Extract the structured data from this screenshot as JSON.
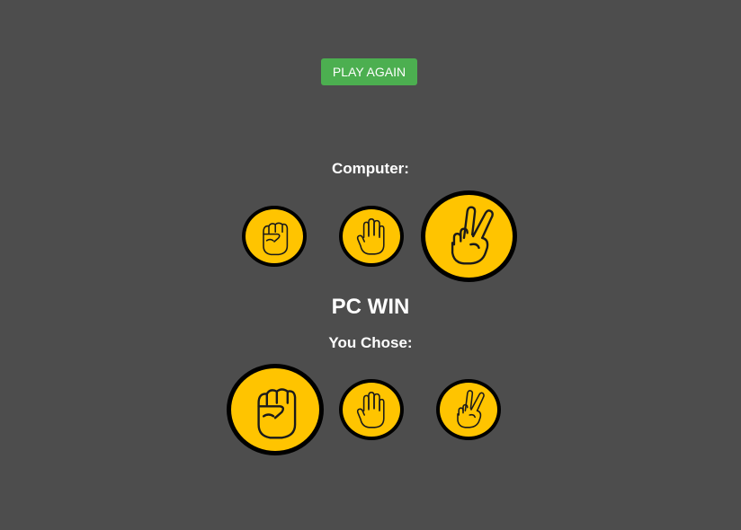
{
  "controls": {
    "play_again_label": "PLAY AGAIN"
  },
  "computer": {
    "label": "Computer:",
    "choices": [
      {
        "name": "rock",
        "icon": "rock-fist-icon",
        "selected": false
      },
      {
        "name": "paper",
        "icon": "paper-hand-icon",
        "selected": false
      },
      {
        "name": "scissors",
        "icon": "scissors-hand-icon",
        "selected": true
      }
    ]
  },
  "result": {
    "text": "PC WIN"
  },
  "player": {
    "label": "You Chose:",
    "choices": [
      {
        "name": "rock",
        "icon": "rock-fist-icon",
        "selected": true
      },
      {
        "name": "paper",
        "icon": "paper-hand-icon",
        "selected": false
      },
      {
        "name": "scissors",
        "icon": "scissors-hand-icon",
        "selected": false
      }
    ]
  },
  "colors": {
    "background": "#4d4d4d",
    "button": "#4caf50",
    "token_fill": "#ffc400",
    "token_border": "#000000",
    "text": "#ffffff"
  }
}
